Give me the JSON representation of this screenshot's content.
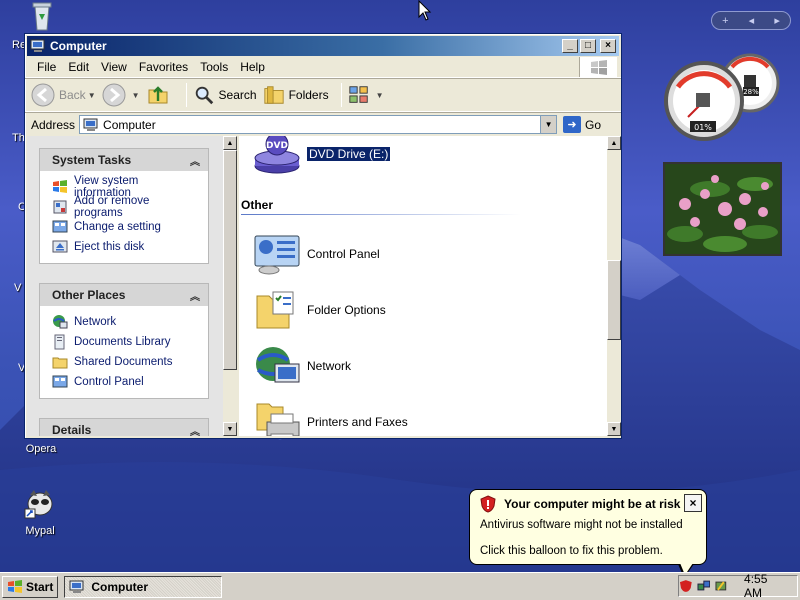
{
  "desktop": {
    "icons": [
      {
        "label": "Opera"
      },
      {
        "label": "Mypal"
      }
    ],
    "partial_labels": [
      "Re",
      "Th",
      "C",
      "V",
      "V"
    ]
  },
  "window": {
    "title": "Computer",
    "controls": {
      "minimize": "_",
      "maximize": "□",
      "close": "×"
    },
    "menu": [
      "File",
      "Edit",
      "View",
      "Favorites",
      "Tools",
      "Help"
    ],
    "toolbar": {
      "back": "Back",
      "search": "Search",
      "folders": "Folders"
    },
    "address": {
      "label": "Address",
      "value": "Computer",
      "go": "Go"
    }
  },
  "left_pane": {
    "system_tasks": {
      "title": "System Tasks",
      "items": [
        {
          "label": "View system information",
          "icon": "system-info-icon"
        },
        {
          "label": "Add or remove programs",
          "icon": "add-remove-programs-icon"
        },
        {
          "label": "Change a setting",
          "icon": "control-panel-icon"
        },
        {
          "label": "Eject this disk",
          "icon": "eject-icon"
        }
      ]
    },
    "other_places": {
      "title": "Other Places",
      "items": [
        {
          "label": "Network",
          "icon": "network-icon"
        },
        {
          "label": "Documents Library",
          "icon": "documents-library-icon"
        },
        {
          "label": "Shared Documents",
          "icon": "folder-icon"
        },
        {
          "label": "Control Panel",
          "icon": "control-panel-icon"
        }
      ]
    },
    "details": {
      "title": "Details"
    }
  },
  "right_pane": {
    "selected_item": "DVD Drive (E:)",
    "dvd_badge": "DVD",
    "group_header": "Other",
    "items": [
      {
        "label": "Control Panel",
        "icon": "control-panel-icon"
      },
      {
        "label": "Folder Options",
        "icon": "folder-options-icon"
      },
      {
        "label": "Network",
        "icon": "network-icon"
      },
      {
        "label": "Printers and Faxes",
        "icon": "printer-icon"
      }
    ]
  },
  "balloon": {
    "title": "Your computer might be at risk",
    "line1": "Antivirus software might not be installed",
    "line2": "Click this balloon to fix this problem.",
    "close": "×"
  },
  "taskbar": {
    "start": "Start",
    "task_window": "Computer",
    "clock": "4:55 AM"
  },
  "gadgets": {
    "cpu_percent": "01%",
    "mem_percent": "28%",
    "bar_add": "+"
  }
}
